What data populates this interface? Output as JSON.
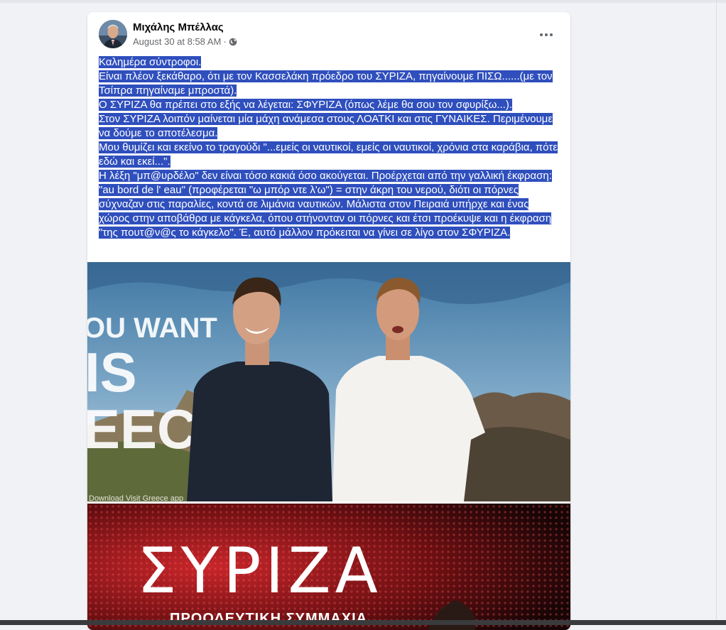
{
  "post": {
    "author": "Μιχάλης Μπέλλας",
    "timestamp": "August 30 at 8:58 AM",
    "separator": "·",
    "privacy_icon": "globe-icon",
    "more_icon": "more-horizontal-icon",
    "lines": [
      "Καλημέρα σύντροφοι.",
      "Είναι πλέον ξεκάθαρο, ότι με τον Κασσελάκη πρόεδρο του ΣΥΡΙΖΑ, πηγαίνουμε ΠΙΣΩ......(με τον Τσίπρα πηγαίναμε μπροστά).",
      "Ο ΣΥΡΙΖΑ θα πρέπει στο εξής να λέγεται: ΣΦΥΡΙΖΑ (όπως λέμε θα σου τον σφυρίξω...).",
      "Στον ΣΥΡΙΖΑ λοιπόν μαίνεται μία μάχη ανάμεσα στους ΛΟΑΤΚΙ και στις ΓΥΝΑΙΚΕΣ. Περιμένουμε να δούμε το αποτέλεσμα.",
      "Μου θυμίζει και εκείνο το τραγούδι \"...εμείς οι ναυτικοί, εμείς οι ναυτικοί, χρόνια στα καράβια, πότε εδώ και εκεί...\".",
      "Η λέξη \"μπ@υρδέλο\" δεν είναι τόσο κακιά όσο ακούγεται. Προέρχεται από την γαλλική έκφραση: \"au bord de l' eau\" (προφέρεται \"ω μπόρ ντε λ'ω\") = στην άκρη του νερού, διότι οι πόρνες σύχναζαν στις παραλίες, κοντά σε λιμάνια ναυτικών. Μάλιστα στον Πειραιά υπήρχε και ένας χώρος στην αποβάθρα με κάγκελα, όπου στήνονταν οι πόρνες και έτσι προέκυψε και η έκφραση \"της πουτ@ν@ς το κάγκελο\". Έ, αυτό μάλλον πρόκειται να γίνει σε λίγο στον ΣΦΥΡΙΖΑ."
    ]
  },
  "image1": {
    "bg_text_1": "OU WANT",
    "bg_text_2": "IS",
    "bg_text_3": "EECI",
    "watermark": "Download Visit Greece app"
  },
  "image2": {
    "logo": "ΣΥΡΙΖΑ",
    "subtitle": "ΠΡΟΟΔΕΥΤΙΚΗ ΣΥΜΜΑΧΙΑ"
  },
  "colors": {
    "selection": "#2f4fbd",
    "page_bg": "#f0f2f5"
  }
}
